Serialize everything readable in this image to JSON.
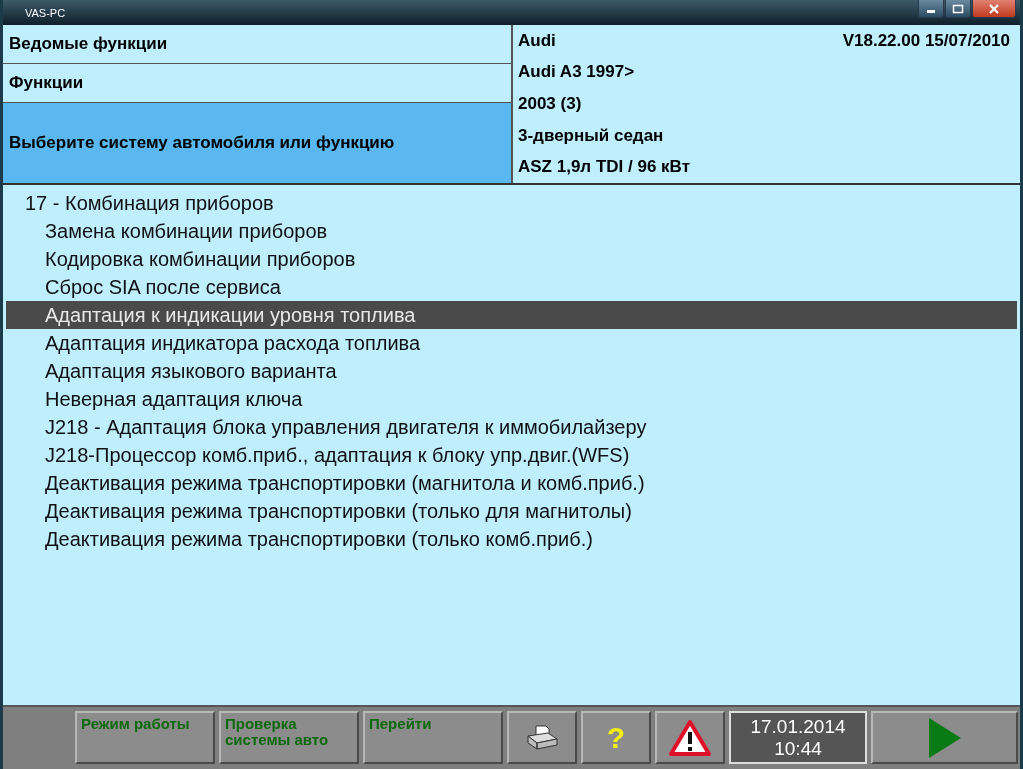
{
  "window": {
    "title": "VAS-PC"
  },
  "header": {
    "rows": [
      {
        "label": "Ведомые функции",
        "selected": false
      },
      {
        "label": "Функции",
        "selected": false
      },
      {
        "label": "Выберите систему автомобиля или функцию",
        "selected": true
      }
    ],
    "vehicle": {
      "make": "Audi",
      "version": "V18.22.00 15/07/2010",
      "model": "Audi A3 1997>",
      "year": "2003 (3)",
      "body": "3-дверный седан",
      "engine": "ASZ 1,9л TDI / 96 кВт"
    }
  },
  "tree": [
    {
      "label": "17 - Комбинация приборов",
      "selected": false,
      "children": [
        {
          "label": "Замена комбинации приборов",
          "selected": false
        },
        {
          "label": "Кодировка комбинации приборов",
          "selected": false
        },
        {
          "label": "Сброс SIA после сервиса",
          "selected": false
        },
        {
          "label": "Адаптация к индикации уровня топлива",
          "selected": true
        },
        {
          "label": "Адаптация индикатора расхода топлива",
          "selected": false
        },
        {
          "label": "Адаптация языкового варианта",
          "selected": false
        },
        {
          "label": "Неверная адаптация ключа",
          "selected": false
        },
        {
          "label": "J218 - Адаптация блока управления двигателя к иммобилайзеру",
          "selected": false
        },
        {
          "label": "J218-Процессор комб.приб., адаптация к блоку упр.двиг.(WFS)",
          "selected": false
        },
        {
          "label": "Деактивация режима транспортировки (магнитола и комб.приб.)",
          "selected": false
        },
        {
          "label": "Деактивация режима транспортировки (только для магнитолы)",
          "selected": false
        },
        {
          "label": "Деактивация режима транспортировки (только комб.приб.)",
          "selected": false
        }
      ]
    }
  ],
  "toolbar": {
    "buttons": [
      {
        "kind": "text",
        "label": "Режим работы"
      },
      {
        "kind": "text",
        "label": "Проверка системы авто"
      },
      {
        "kind": "text",
        "label": "Перейти"
      },
      {
        "kind": "print"
      },
      {
        "kind": "help",
        "label": "?"
      },
      {
        "kind": "warning"
      }
    ],
    "date": "17.01.2014",
    "time": "10:44"
  }
}
